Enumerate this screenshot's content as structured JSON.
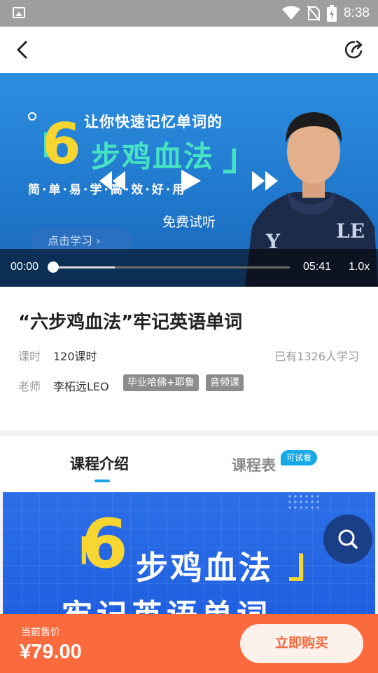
{
  "status_bar": {
    "time": "8:38"
  },
  "video": {
    "banner_subtitle": "让你快速记忆单词的",
    "banner_number": "6",
    "banner_title": "步鸡血法",
    "banner_bracket_left": "「",
    "banner_bracket_right": "」",
    "banner_tagline": "简·单·易·学·高·效·好·用",
    "banner_button": "点击学习 ›",
    "free_trial": "免费试听",
    "current_time": "00:00",
    "total_time": "05:41",
    "speed": "1.0x",
    "progress": 0,
    "buffered": 0.26
  },
  "course": {
    "title": "“六步鸡血法”牢记英语单词",
    "hours_label": "课时",
    "hours_value": "120课时",
    "learners": "已有1326人学习",
    "teacher_label": "老师",
    "teacher_name": "李柘远LEO",
    "tags": [
      "毕业哈佛+耶鲁",
      "音频课"
    ]
  },
  "tabs": {
    "intro": "课程介绍",
    "schedule": "课程表",
    "schedule_badge": "可试看"
  },
  "intro_image": {
    "number": "6",
    "title": "步鸡血法",
    "bracket_left": "「",
    "bracket_right": "」",
    "subtitle": "牢记英语单词"
  },
  "bottom_bar": {
    "price_label": "当前售价",
    "price": "¥79.00",
    "buy_label": "立即购买"
  },
  "colors": {
    "accent_blue": "#16a8e8",
    "buy_bar": "#fb6a3c",
    "banner_teal": "#45e3c3",
    "banner_yellow": "#f7d631"
  },
  "icons": [
    "image-icon",
    "wifi-icon",
    "no-sim-icon",
    "battery-icon",
    "back-arrow-icon",
    "share-icon",
    "rewind-icon",
    "play-icon",
    "fast-forward-icon",
    "search-icon"
  ]
}
